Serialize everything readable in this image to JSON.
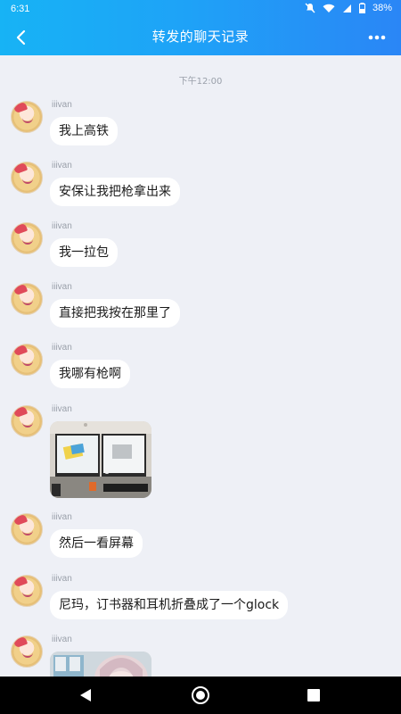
{
  "status_bar": {
    "time": "6:31",
    "battery": "38%"
  },
  "header": {
    "title": "转发的聊天记录"
  },
  "chat": {
    "time_divider": "下午12:00",
    "messages": [
      {
        "sender": "iiivan",
        "text": "我上高铁"
      },
      {
        "sender": "iiivan",
        "text": "安保让我把枪拿出来"
      },
      {
        "sender": "iiivan",
        "text": "我一拉包"
      },
      {
        "sender": "iiivan",
        "text": "直接把我按在那里了"
      },
      {
        "sender": "iiivan",
        "text": "我哪有枪啊"
      },
      {
        "sender": "iiivan",
        "type": "image",
        "icon": "photo-of-desk-with-monitors"
      },
      {
        "sender": "iiivan",
        "text": "然后一看屏幕"
      },
      {
        "sender": "iiivan",
        "text": "尼玛，订书器和耳机折叠成了一个glock"
      },
      {
        "sender": "iiivan",
        "type": "image",
        "icon": "photo-of-anime-character"
      }
    ]
  },
  "colors": {
    "header_start": "#17b3f5",
    "header_end": "#2a86f6",
    "background": "#eef0f6",
    "bubble": "#ffffff"
  }
}
